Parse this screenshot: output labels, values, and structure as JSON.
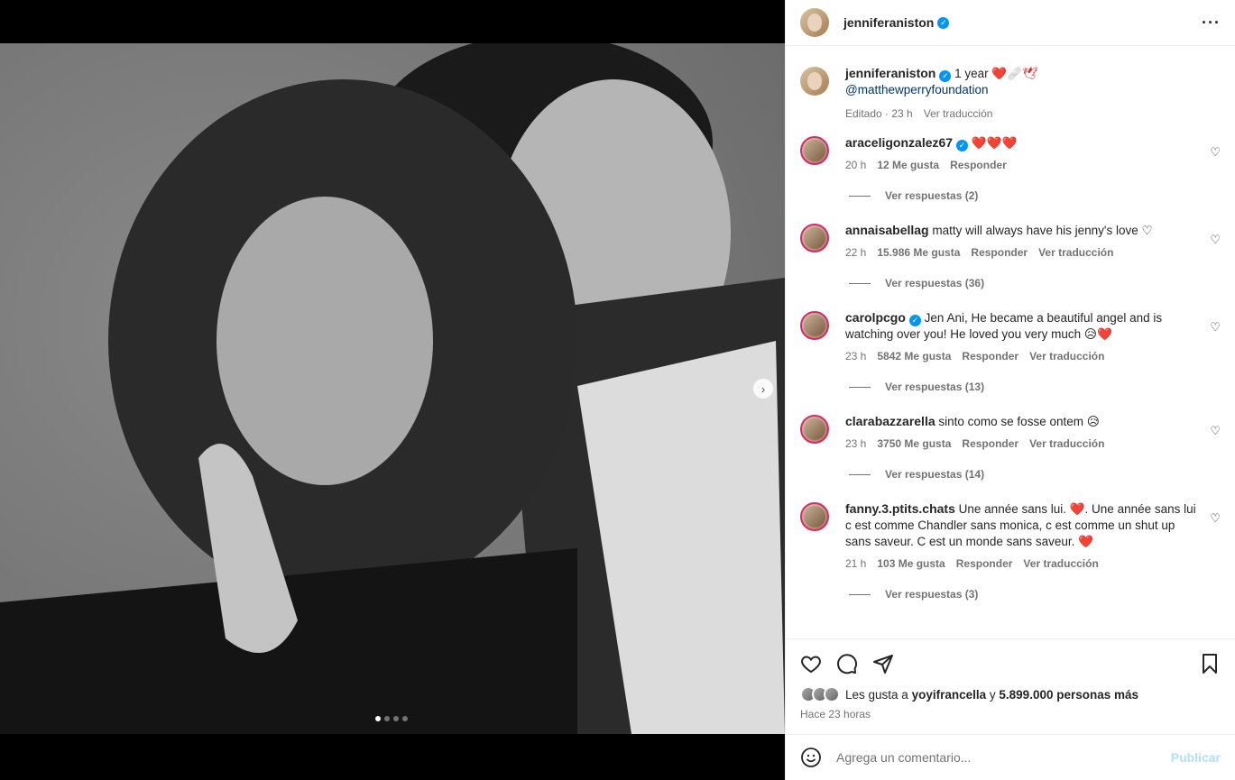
{
  "post": {
    "author": "jenniferaniston",
    "caption_text": "1 year",
    "caption_emojis": "❤️🩹🕊",
    "mention": "@matthewperryfoundation",
    "edited_label": "Editado",
    "edited_time": "23 h",
    "translate_label": "Ver traducción"
  },
  "comments": [
    {
      "user": "araceligonzalez67",
      "verified": true,
      "text": "❤️❤️❤️",
      "time": "20 h",
      "likes": "12 Me gusta",
      "reply": "Responder",
      "translate": "",
      "replies": "Ver respuestas (2)"
    },
    {
      "user": "annaisabellag",
      "verified": false,
      "text": "matty will always have his jenny's love ♡",
      "time": "22 h",
      "likes": "15.986 Me gusta",
      "reply": "Responder",
      "translate": "Ver traducción",
      "replies": "Ver respuestas (36)"
    },
    {
      "user": "carolpcgo",
      "verified": true,
      "text": "Jen Ani, He became a beautiful angel and is watching over you! He loved you very much 😥❤️",
      "time": "23 h",
      "likes": "5842 Me gusta",
      "reply": "Responder",
      "translate": "Ver traducción",
      "replies": "Ver respuestas (13)"
    },
    {
      "user": "clarabazzarella",
      "verified": false,
      "text": "sinto como se fosse ontem 😥",
      "time": "23 h",
      "likes": "3750 Me gusta",
      "reply": "Responder",
      "translate": "Ver traducción",
      "replies": "Ver respuestas (14)"
    },
    {
      "user": "fanny.3.ptits.chats",
      "verified": false,
      "text": "Une année sans lui. ❤️. Une année sans lui c est comme Chandler sans monica, c est comme un shut up sans saveur. C est un monde sans saveur. ❤️",
      "time": "21 h",
      "likes": "103 Me gusta",
      "reply": "Responder",
      "translate": "Ver traducción",
      "replies": "Ver respuestas (3)"
    }
  ],
  "likes": {
    "prefix": "Les gusta a",
    "user": "yoyifrancella",
    "middle": "y",
    "count": "5.899.000 personas más"
  },
  "time_ago": "Hace 23 horas",
  "add_comment": {
    "placeholder": "Agrega un comentario...",
    "publish": "Publicar"
  },
  "carousel": {
    "count": 4,
    "active_index": 0
  },
  "colors": {
    "accent": "#0095f6",
    "ring": "#d62976",
    "link": "#00376b",
    "muted": "#737373"
  }
}
